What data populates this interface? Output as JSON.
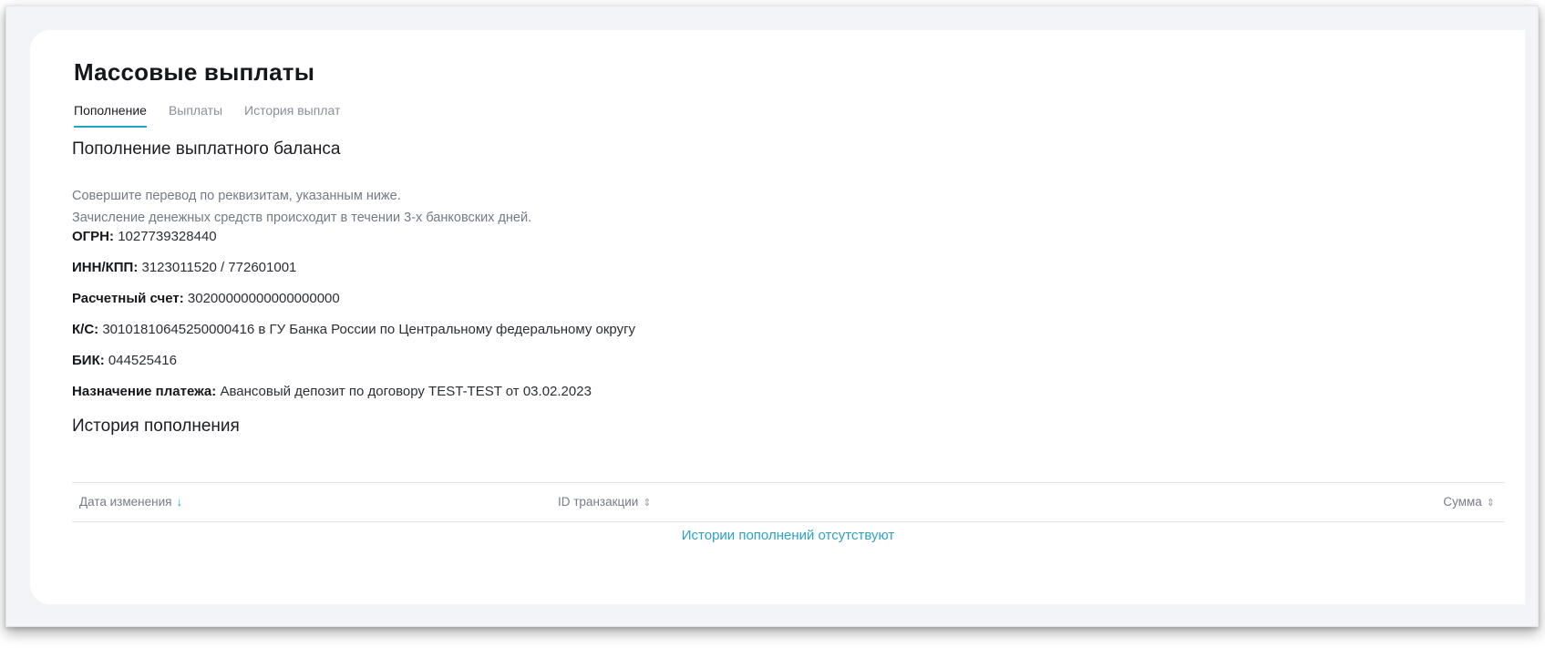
{
  "page": {
    "title": "Массовые выплаты"
  },
  "tabs": [
    {
      "label": "Пополнение",
      "active": true
    },
    {
      "label": "Выплаты",
      "active": false
    },
    {
      "label": "История выплат",
      "active": false
    }
  ],
  "topup": {
    "title": "Пополнение выплатного баланса",
    "description_line1": "Совершите перевод по реквизитам, указанным ниже.",
    "description_line2": "Зачисление денежных средств происходит в течении 3-х банковских дней."
  },
  "requisites": [
    {
      "label": "ОГРН:",
      "value": "1027739328440"
    },
    {
      "label": "ИНН/КПП:",
      "value": "3123011520 / 772601001"
    },
    {
      "label": "Расчетный счет:",
      "value": "30200000000000000000"
    },
    {
      "label": "К/С:",
      "value": "30101810645250000416 в ГУ Банка России по Центральному федеральному округу"
    },
    {
      "label": "БИК:",
      "value": "044525416"
    },
    {
      "label": "Назначение платежа:",
      "value": "Авансовый депозит по договору TEST-TEST от 03.02.2023"
    }
  ],
  "history": {
    "title": "История пополнения",
    "columns": [
      {
        "label": "Дата изменения",
        "sort_icon": "arrow-down-icon"
      },
      {
        "label": "ID транзакции",
        "sort_icon": "sort-icon"
      },
      {
        "label": "Сумма",
        "sort_icon": "sort-icon"
      }
    ],
    "empty_text": "Истории пополнений отсутствуют"
  },
  "colors": {
    "accent": "#1aa6c6",
    "link": "#2ea3c4"
  }
}
